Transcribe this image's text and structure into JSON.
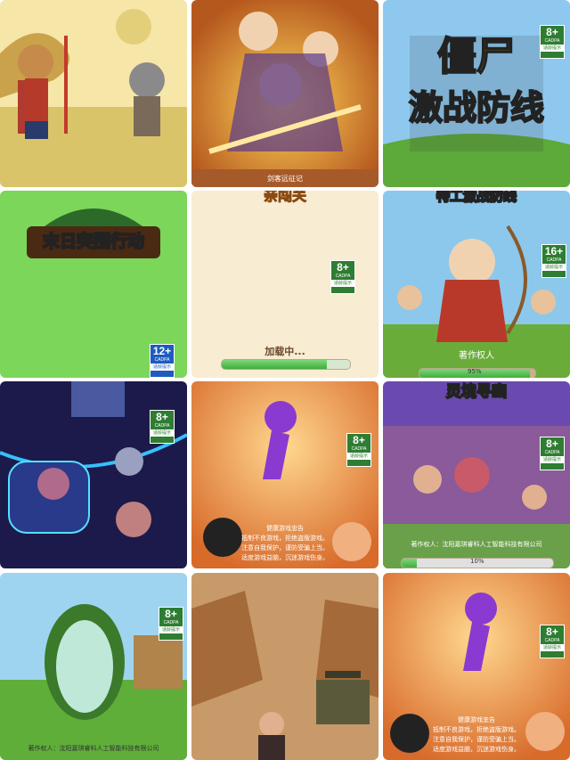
{
  "tiles": [
    {
      "id": "monkey-wolf"
    },
    {
      "id": "swordsman",
      "caption": "剑客远征记"
    },
    {
      "id": "zombie",
      "title_line1": "僵尸",
      "title_line2": "激战防线",
      "rating": {
        "age": "8+",
        "org": "CADPA",
        "tip": "适龄提示"
      }
    },
    {
      "id": "doomsday",
      "title": "末日突围行动",
      "rating": {
        "age": "12+",
        "org": "CADPA",
        "tip": "适龄提示"
      }
    },
    {
      "id": "loading",
      "top_text": "亲闯关",
      "loading_text": "加载中...",
      "progress": 0.82,
      "rating": {
        "age": "8+",
        "org": "CADPA",
        "tip": "适龄提示"
      }
    },
    {
      "id": "special-defense",
      "title": "特工激战防线",
      "copyright": "著作权人",
      "percent": "95%",
      "progress": 0.95,
      "rating": {
        "age": "16+",
        "org": "CADPA",
        "tip": "适龄提示"
      }
    },
    {
      "id": "robots",
      "rating": {
        "age": "8+",
        "org": "CADPA",
        "tip": "适龄提示"
      }
    },
    {
      "id": "purple-man",
      "notice_title": "健康游戏忠告",
      "notice_lines": [
        "抵制不良游戏，拒绝盗版游戏。",
        "注意自我保护，谨防受骗上当。",
        "适度游戏益脑，沉迷游戏伤身。"
      ],
      "rating": {
        "age": "8+",
        "org": "CADPA",
        "tip": "适龄提示"
      }
    },
    {
      "id": "spirit-realm",
      "title": "灵境寻幽",
      "copyright": "著作权人：沈阳嘉琪睿科人工智能科技有限公司",
      "percent": "10%",
      "progress": 0.1,
      "rating": {
        "age": "8+",
        "org": "CADPA",
        "tip": "适龄提示"
      }
    },
    {
      "id": "portal",
      "copyright": "著作权人：沈阳嘉琪睿科人工智能科技有限公司",
      "rating": {
        "age": "8+",
        "org": "CADPA",
        "tip": "适龄提示"
      }
    },
    {
      "id": "war-ruins"
    },
    {
      "id": "purple-man-2",
      "notice_title": "健康游戏忠告",
      "notice_lines": [
        "抵制不良游戏，拒绝盗版游戏。",
        "注意自我保护，谨防受骗上当。",
        "适度游戏益脑，沉迷游戏伤身。"
      ],
      "rating": {
        "age": "8+",
        "org": "CADPA",
        "tip": "适龄提示"
      }
    }
  ],
  "colors": {
    "rating_green": "#2e7d32",
    "rating_blue": "#1e5bbf",
    "title_yellow": "#ffe600"
  }
}
